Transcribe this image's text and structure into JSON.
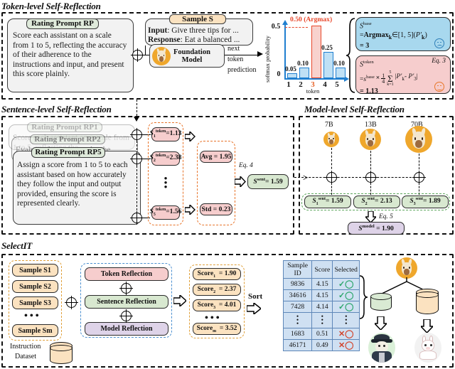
{
  "sections": {
    "token": {
      "title": "Token-level Self-Reflection"
    },
    "sentence": {
      "title": "Sentence-level Self-Reflection"
    },
    "model": {
      "title": "Model-level Self-Reflection"
    },
    "selectit": {
      "title": "SelectIT"
    }
  },
  "token_level": {
    "rating_prompt_tag": "Rating Prompt RP",
    "rating_prompt_text": "Score each assistant on a scale from 1 to 5, reflecting the accuracy of their adherence to the instructions and input, and present this score plainly.",
    "sample_tag": "Sample S",
    "sample_input_label": "Input",
    "sample_input_text": ": Give three tips for ...",
    "sample_response_label": "Response",
    "sample_response_text": ": Eat a balanced ...",
    "foundation_model_line1": "Foundation",
    "foundation_model_line2": "Model",
    "next_token_l1": "next",
    "next_token_l2": "token",
    "next_token_l3": "prediction",
    "base_eq": {
      "line1": "S base",
      "line2": "= Argmax k∈[1, 5] ( P'k )",
      "line3": "= 3",
      "face": "sad-face-icon"
    },
    "token_eq": {
      "eq_ref": "Eq. 3",
      "line1": "S token",
      "line2": "= s base × 1/4 Σ k=1..5 | P'k - P'3 |",
      "line3": "= 1.13",
      "face": "happy-face-icon"
    }
  },
  "chart_data": {
    "type": "bar",
    "title": "",
    "categories": [
      "1",
      "2",
      "3",
      "4",
      "5"
    ],
    "values": [
      0.05,
      0.1,
      0.5,
      0.25,
      0.1
    ],
    "value_labels": [
      "0.05",
      "0.10",
      "0.50",
      "0.25",
      "0.10"
    ],
    "highlight_index": 2,
    "highlight_label": "0.50 (Argmax)",
    "xlabel": "token",
    "ylabel": "softmax probability",
    "ylim": [
      0,
      0.5
    ],
    "ytick_labels": [
      "0",
      "0.5"
    ],
    "grid": false,
    "legend": "none",
    "bar_color": "#bfe0f5",
    "bar_edge_color": "#1f7fd0",
    "highlight_color": "#f8d2cd",
    "highlight_edge_color": "#e8472a",
    "axis_color": "#1f7fd0"
  },
  "sentence_level": {
    "prompts": [
      {
        "tag": "Rating Prompt RP1",
        "text": "Score each assistant on a scale from 1 to 5, reflecting the"
      },
      {
        "tag": "Rating Prompt RP2",
        "text": "Evaluate the assistants by the correctness of their response to"
      },
      {
        "tag": "Rating Prompt RP5",
        "text": "Assign a score from 1 to 5 to each assistant based on how accurately they follow the input and output provided, ensuring the score is represented clearly."
      }
    ],
    "token_scores": [
      {
        "label": "S1token",
        "value": "=1.13"
      },
      {
        "label": "S2token",
        "value": "=2.38"
      },
      {
        "label": "S5token",
        "value": "=1.56"
      }
    ],
    "avg": "Avg = 1.95",
    "std": "Std = 0.23",
    "eq_ref": "Eq. 4",
    "result": "Ssent= 1.59"
  },
  "model_level": {
    "model_sizes": [
      "7B",
      "13B",
      "70B"
    ],
    "sent_scores": [
      "S1sent= 1.59",
      "S2sent= 2.13",
      "S3sent= 1.89"
    ],
    "eq_ref": "Eq. 5",
    "result": "Smodel = 1.90"
  },
  "selectit": {
    "samples": [
      "Sample S1",
      "Sample S2",
      "Sample S3",
      "Sample Sm"
    ],
    "dataset_label_l1": "Instruction",
    "dataset_label_l2": "Dataset",
    "reflections": [
      "Token Reflection",
      "Sentence Reflection",
      "Model Reflection"
    ],
    "scores": [
      "Score1  = 1.90",
      "Score2  = 2.37",
      "Score3  = 4.01",
      "Scorem  = 3.52"
    ],
    "sort_label": "Sort",
    "table": {
      "headers": [
        "Sample ID",
        "Score",
        "Selected"
      ],
      "rows": [
        {
          "id": "9836",
          "score": "4.15",
          "selected": "check-icon"
        },
        {
          "id": "34616",
          "score": "4.15",
          "selected": "check-icon"
        },
        {
          "id": "7428",
          "score": "4.14",
          "selected": "check-icon"
        },
        {
          "id": "dots",
          "score": "dots",
          "selected": "dots"
        },
        {
          "id": "1683",
          "score": "0.51",
          "selected": "cross-icon"
        },
        {
          "id": "46171",
          "score": "0.49",
          "selected": "cross-icon"
        }
      ]
    }
  }
}
